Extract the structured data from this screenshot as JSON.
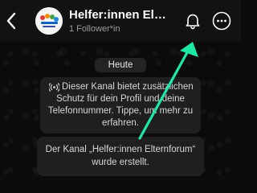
{
  "header": {
    "title": "Helfer:innen Elternf...",
    "subtitle": "1 Follower*in"
  },
  "icons": {
    "back": "chevron-left-icon",
    "avatar": "channel-logo-avatar",
    "notifications": "bell-icon",
    "more": "more-options-icon",
    "privacy": "broadcast-icon"
  },
  "chat": {
    "date_label": "Heute",
    "info_lines": [
      "Dieser Kanal bietet zusätzlichen",
      "Schutz für dein Profil und deine",
      "Telefonnummer. Tippe, um mehr zu",
      "erfahren."
    ],
    "created_lines": [
      "Der Kanal „Helfer:innen Elternforum“",
      "wurde erstellt."
    ]
  },
  "colors": {
    "background": "#0b0b0b",
    "header": "#121212",
    "bubble": "#1f1f1f",
    "annotation_arrow": "#1de9a6"
  }
}
